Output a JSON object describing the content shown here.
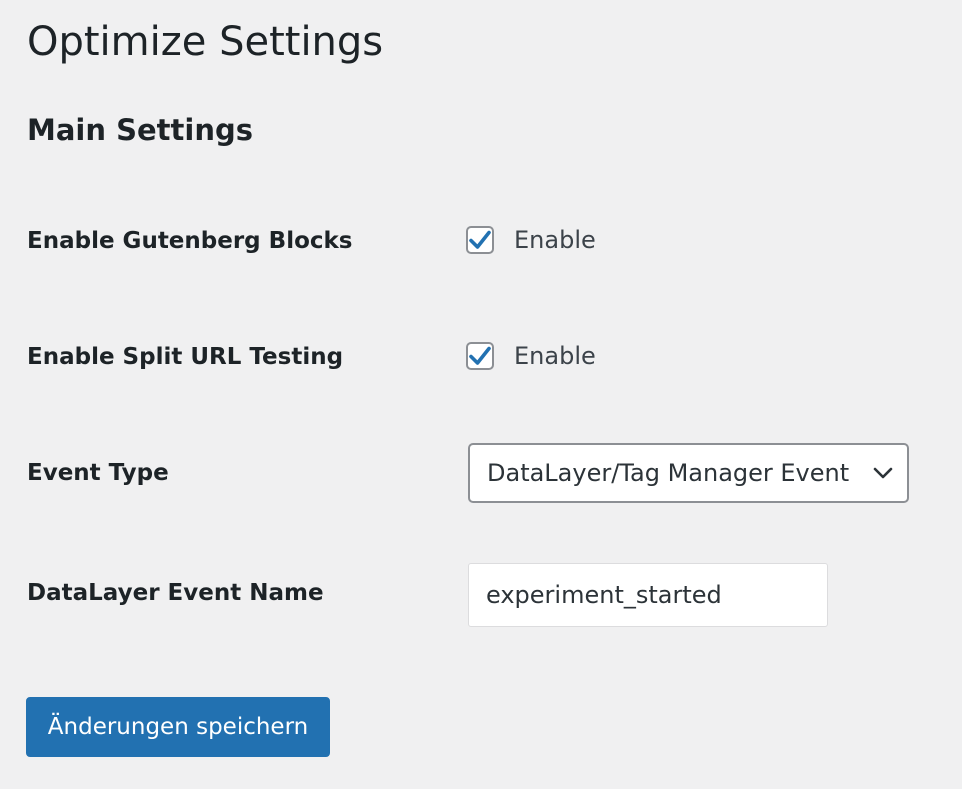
{
  "page": {
    "title": "Optimize Settings"
  },
  "section": {
    "title": "Main Settings"
  },
  "settings": {
    "gutenberg": {
      "label": "Enable Gutenberg Blocks",
      "checkbox_label": "Enable",
      "checked": true
    },
    "split_url": {
      "label": "Enable Split URL Testing",
      "checkbox_label": "Enable",
      "checked": true
    },
    "event_type": {
      "label": "Event Type",
      "selected": "DataLayer/Tag Manager Event"
    },
    "event_name": {
      "label": "DataLayer Event Name",
      "value": "experiment_started"
    }
  },
  "actions": {
    "save_label": "Änderungen speichern"
  },
  "colors": {
    "background": "#f0f0f1",
    "primary": "#2271b1",
    "checkmark": "#2271b1",
    "text": "#1d2327"
  },
  "icons": {
    "checkbox": "checkmark-icon",
    "select": "chevron-down-icon"
  }
}
